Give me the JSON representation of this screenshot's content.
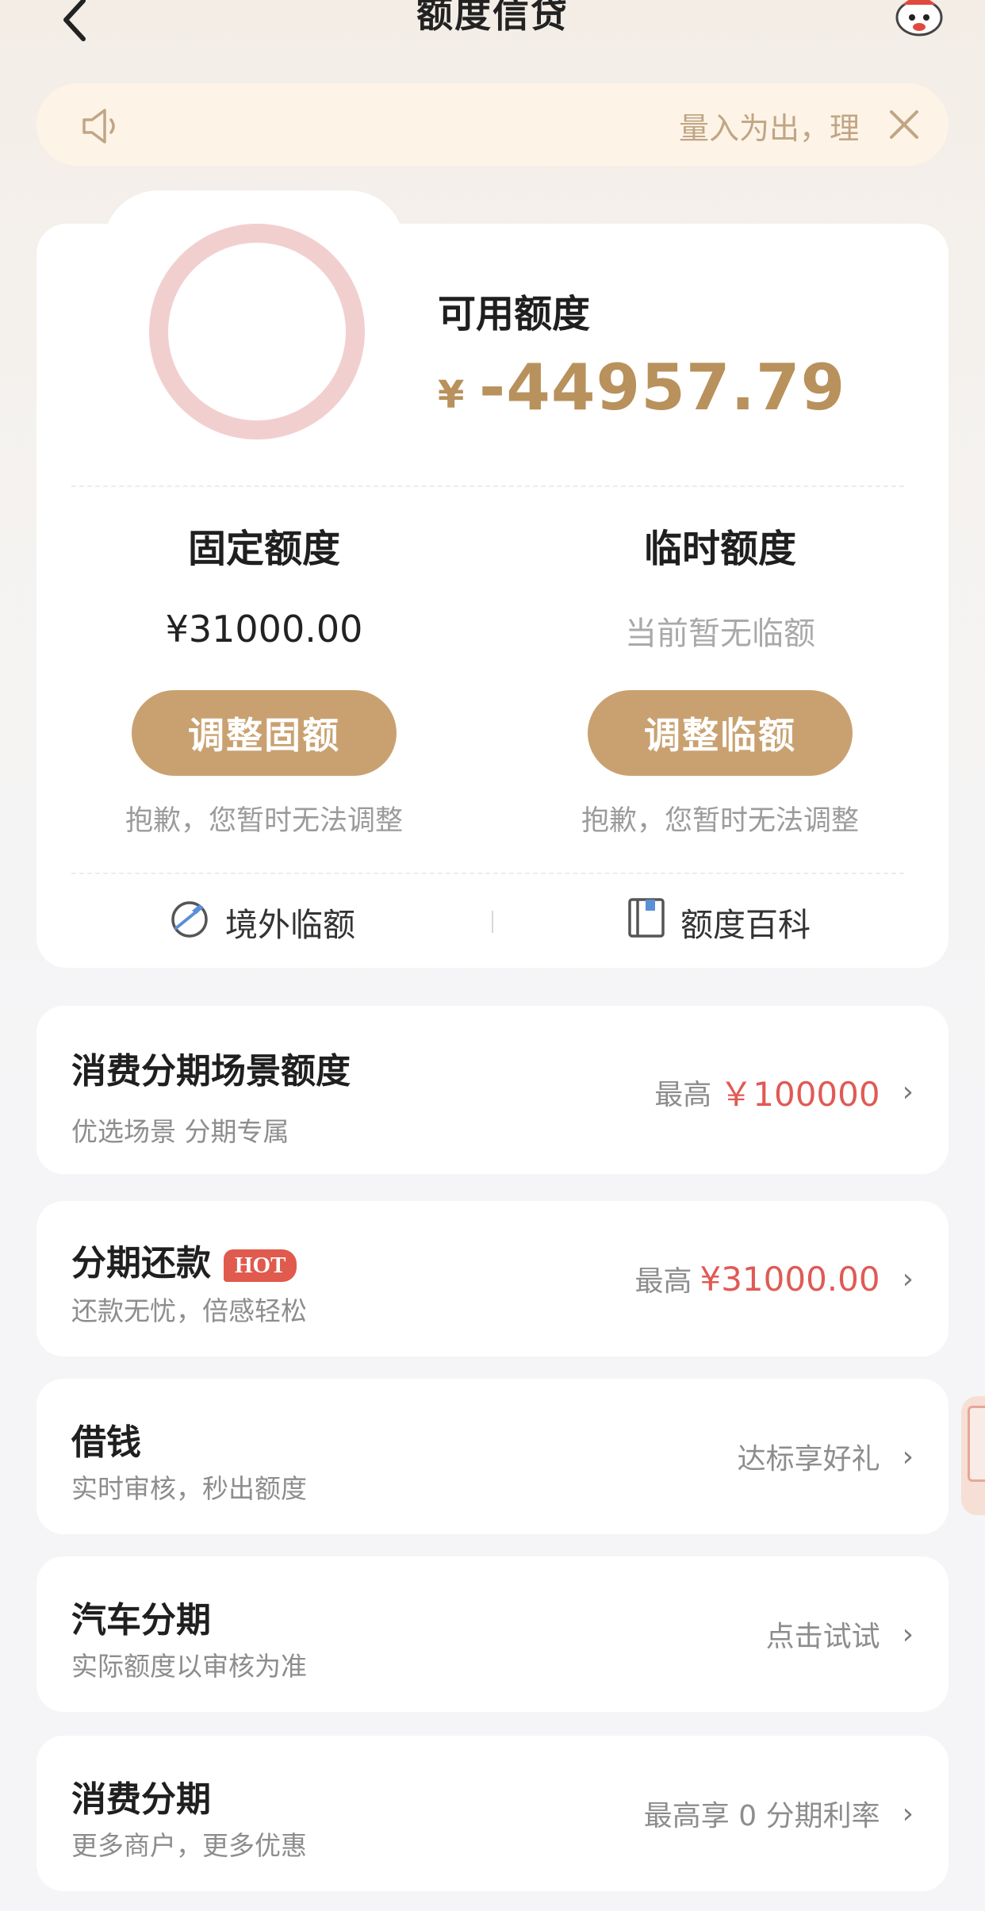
{
  "header": {
    "title": "额度信贷",
    "back_icon": "chevron-left-icon",
    "mascot_icon": "mascot-avatar-icon"
  },
  "notice": {
    "text": "量入为出，理",
    "speaker_icon": "speaker-icon",
    "close_icon": "close-icon"
  },
  "available": {
    "label": "可用额度",
    "currency": "¥",
    "value": "-44957.79"
  },
  "fixed": {
    "title": "固定额度",
    "value": "¥31000.00",
    "button": "调整固额",
    "note": "抱歉，您暂时无法调整"
  },
  "temporary": {
    "title": "临时额度",
    "value": "当前暂无临额",
    "button": "调整临额",
    "note": "抱歉，您暂时无法调整"
  },
  "links": {
    "overseas": "境外临额",
    "wiki": "额度百科"
  },
  "list": [
    {
      "title": "消费分期场景额度",
      "sub": "优选场景 分期专属",
      "right_label": "最高",
      "right_amount": "￥100000"
    },
    {
      "title": "分期还款",
      "badge": "HOT",
      "sub": "还款无忧，倍感轻松",
      "right_label": "最高",
      "right_amount": "¥31000.00"
    },
    {
      "title": "借钱",
      "sub": "实时审核，秒出额度",
      "right_label": "达标享好礼"
    },
    {
      "title": "汽车分期",
      "sub": "实际额度以审核为准",
      "right_label": "点击试试"
    },
    {
      "title": "消费分期",
      "sub": "更多商户，更多优惠",
      "right_label": "最高享 0 分期利率"
    }
  ],
  "colors": {
    "gold": "#b8915c",
    "button_gold": "#c9a170",
    "red": "#e05a55",
    "ring": "#f2cfcf"
  }
}
